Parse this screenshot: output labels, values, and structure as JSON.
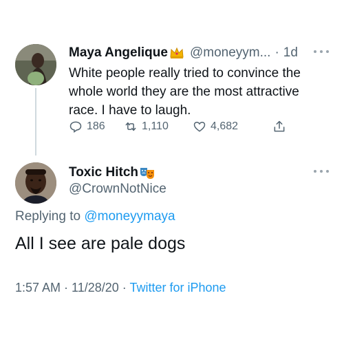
{
  "parent_tweet": {
    "display_name": "Maya Angelique",
    "name_emoji": "crown-emoji",
    "handle": "@moneyym...",
    "separator": "·",
    "time": "1d",
    "text": "White people really tried to convince the whole world they are the most attractive race. I have to laugh.",
    "actions": {
      "replies": "186",
      "retweets": "1,110",
      "likes": "4,682"
    }
  },
  "reply_tweet": {
    "display_name": "Toxic Hitch",
    "name_emoji": "performing-arts-masks-emoji",
    "handle": "@CrownNotNice",
    "replying_prefix": "Replying to",
    "replying_to": "@moneyymaya",
    "text": "All I see are pale dogs",
    "timestamp": "1:57 AM · 11/28/20",
    "meta_separator": "·",
    "source": "Twitter for iPhone"
  },
  "colors": {
    "link": "#1d9bf0",
    "secondary_text": "#536471",
    "primary_text": "#0f1419"
  }
}
